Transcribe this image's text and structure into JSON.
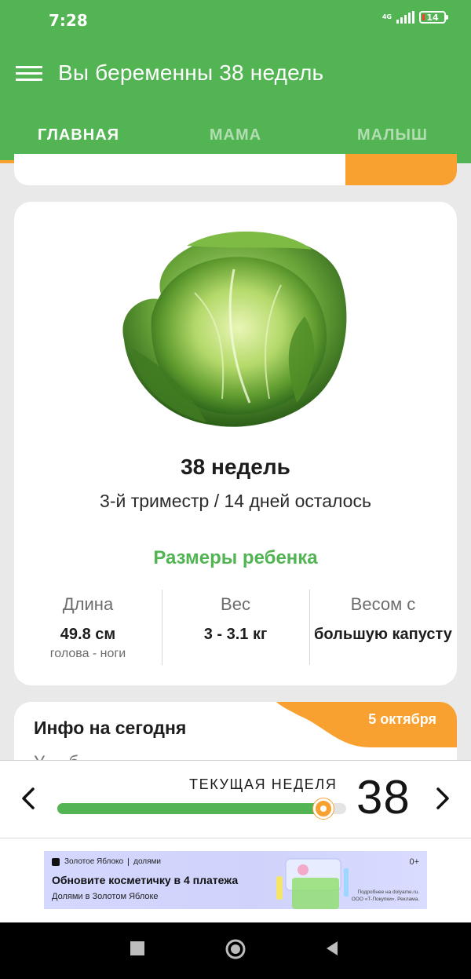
{
  "status_bar": {
    "time": "7:28",
    "network": "4G",
    "battery": "14"
  },
  "app_bar": {
    "title": "Вы беременны 38 недель"
  },
  "tabs": [
    {
      "label": "ГЛАВНАЯ",
      "active": true
    },
    {
      "label": "МАМА",
      "active": false
    },
    {
      "label": "МАЛЫШ",
      "active": false
    }
  ],
  "main_card": {
    "image_icon": "cabbage-image",
    "weeks": "38 недель",
    "trimester": "3-й триместр / 14 дней осталось",
    "sizes_title": "Размеры ребенка",
    "stats": [
      {
        "label": "Длина",
        "value": "49.8 см",
        "sub": "голова - ноги"
      },
      {
        "label": "Вес",
        "value": "3 - 3.1 кг",
        "sub": ""
      },
      {
        "label": "Весом с",
        "value": "большую капусту",
        "sub": ""
      }
    ]
  },
  "info_card": {
    "title": "Инфо на сегодня",
    "date": "5 октября",
    "preview_text": "У ... б"
  },
  "week_bar": {
    "label": "ТЕКУЩАЯ НЕДЕЛЯ",
    "week": "38",
    "progress": 0.92
  },
  "ad": {
    "brand": "Золотое Яблоко",
    "partner": "долями",
    "headline": "Обновите косметичку в 4 платежа",
    "subline": "Долями в Золотом Яблоке",
    "age": "0+",
    "legal_line1": "Подробнее на dolyame.ru.",
    "legal_line2": "ООО «Т-Покупки». Реклама."
  },
  "colors": {
    "green": "#52b453",
    "orange": "#f9a130"
  }
}
